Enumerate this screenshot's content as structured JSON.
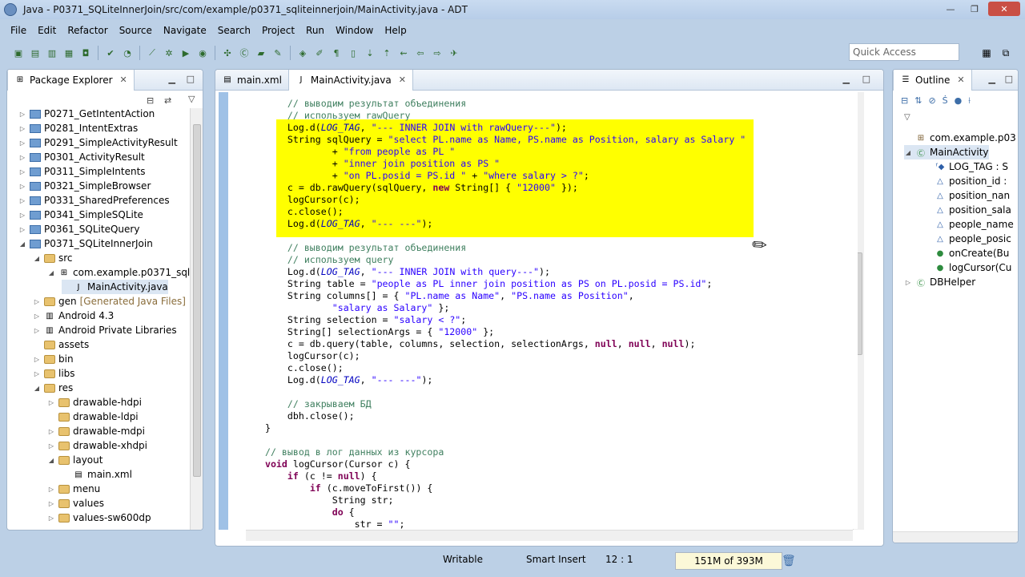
{
  "window": {
    "title": "Java - P0371_SQLiteInnerJoin/src/com/example/p0371_sqliteinnerjoin/MainActivity.java - ADT",
    "controls": [
      "—",
      "❐",
      "✕"
    ]
  },
  "menu": [
    "File",
    "Edit",
    "Refactor",
    "Source",
    "Navigate",
    "Search",
    "Project",
    "Run",
    "Window",
    "Help"
  ],
  "quick_access": {
    "placeholder": "Quick Access"
  },
  "package_explorer": {
    "tab_label": "Package Explorer",
    "items": [
      {
        "label": "P0271_GetIntentAction",
        "indent": 0,
        "expanded": false,
        "icon": "project-icon"
      },
      {
        "label": "P0281_IntentExtras",
        "indent": 0,
        "expanded": false,
        "icon": "project-icon"
      },
      {
        "label": "P0291_SimpleActivityResult",
        "indent": 0,
        "expanded": false,
        "icon": "project-icon"
      },
      {
        "label": "P0301_ActivityResult",
        "indent": 0,
        "expanded": false,
        "icon": "project-icon"
      },
      {
        "label": "P0311_SimpleIntents",
        "indent": 0,
        "expanded": false,
        "icon": "project-icon"
      },
      {
        "label": "P0321_SimpleBrowser",
        "indent": 0,
        "expanded": false,
        "icon": "project-icon"
      },
      {
        "label": "P0331_SharedPreferences",
        "indent": 0,
        "expanded": false,
        "icon": "project-icon"
      },
      {
        "label": "P0341_SimpleSQLite",
        "indent": 0,
        "expanded": false,
        "icon": "project-icon"
      },
      {
        "label": "P0361_SQLiteQuery",
        "indent": 0,
        "expanded": false,
        "icon": "project-icon"
      },
      {
        "label": "P0371_SQLiteInnerJoin",
        "indent": 0,
        "expanded": true,
        "icon": "project-icon"
      },
      {
        "label": "src",
        "indent": 1,
        "expanded": true,
        "icon": "folder-icon"
      },
      {
        "label": "com.example.p0371_sqlit",
        "indent": 2,
        "expanded": true,
        "icon": "package-icon"
      },
      {
        "label": "MainActivity.java",
        "indent": 3,
        "expanded": null,
        "icon": "java-file-icon",
        "selected": true
      },
      {
        "label": "gen",
        "suffix": "[Generated Java Files]",
        "indent": 1,
        "expanded": false,
        "icon": "folder-icon"
      },
      {
        "label": "Android 4.3",
        "indent": 1,
        "expanded": false,
        "icon": "library-icon"
      },
      {
        "label": "Android Private Libraries",
        "indent": 1,
        "expanded": false,
        "icon": "library-icon"
      },
      {
        "label": "assets",
        "indent": 1,
        "expanded": null,
        "icon": "folder-icon"
      },
      {
        "label": "bin",
        "indent": 1,
        "expanded": false,
        "icon": "folder-icon"
      },
      {
        "label": "libs",
        "indent": 1,
        "expanded": false,
        "icon": "folder-icon"
      },
      {
        "label": "res",
        "indent": 1,
        "expanded": true,
        "icon": "folder-icon"
      },
      {
        "label": "drawable-hdpi",
        "indent": 2,
        "expanded": false,
        "icon": "folder-icon"
      },
      {
        "label": "drawable-ldpi",
        "indent": 2,
        "expanded": null,
        "icon": "folder-icon"
      },
      {
        "label": "drawable-mdpi",
        "indent": 2,
        "expanded": false,
        "icon": "folder-icon"
      },
      {
        "label": "drawable-xhdpi",
        "indent": 2,
        "expanded": false,
        "icon": "folder-icon"
      },
      {
        "label": "layout",
        "indent": 2,
        "expanded": true,
        "icon": "folder-icon"
      },
      {
        "label": "main.xml",
        "indent": 3,
        "expanded": null,
        "icon": "xml-file-icon"
      },
      {
        "label": "menu",
        "indent": 2,
        "expanded": false,
        "icon": "folder-icon"
      },
      {
        "label": "values",
        "indent": 2,
        "expanded": false,
        "icon": "folder-icon"
      },
      {
        "label": "values-sw600dp",
        "indent": 2,
        "expanded": false,
        "icon": "folder-icon"
      }
    ]
  },
  "editor": {
    "tabs": [
      {
        "label": "main.xml",
        "active": false
      },
      {
        "label": "MainActivity.java",
        "active": true
      }
    ],
    "lines": [
      [
        {
          "t": "      ",
          "c": ""
        },
        {
          "t": "// выводим результат объединения",
          "c": "cm"
        }
      ],
      [
        {
          "t": "      ",
          "c": ""
        },
        {
          "t": "// используем rawQuery",
          "c": "cm"
        }
      ],
      [
        {
          "t": "      Log.d(",
          "c": ""
        },
        {
          "t": "LOG_TAG",
          "c": "fld"
        },
        {
          "t": ", ",
          "c": ""
        },
        {
          "t": "\"--- INNER JOIN with rawQuery---\"",
          "c": "str"
        },
        {
          "t": ");",
          "c": ""
        }
      ],
      [
        {
          "t": "      String sqlQuery = ",
          "c": ""
        },
        {
          "t": "\"select PL.name as Name, PS.name as Position, salary as Salary \"",
          "c": "str"
        }
      ],
      [
        {
          "t": "              + ",
          "c": ""
        },
        {
          "t": "\"from people as PL \"",
          "c": "str"
        }
      ],
      [
        {
          "t": "              + ",
          "c": ""
        },
        {
          "t": "\"inner join position as PS \"",
          "c": "str"
        }
      ],
      [
        {
          "t": "              + ",
          "c": ""
        },
        {
          "t": "\"on PL.posid = PS.id \"",
          "c": "str"
        },
        {
          "t": " + ",
          "c": ""
        },
        {
          "t": "\"where salary > ?\"",
          "c": "str"
        },
        {
          "t": ";",
          "c": ""
        }
      ],
      [
        {
          "t": "      c = db.rawQuery(sqlQuery, ",
          "c": ""
        },
        {
          "t": "new",
          "c": "kw"
        },
        {
          "t": " String[] { ",
          "c": ""
        },
        {
          "t": "\"12000\"",
          "c": "str"
        },
        {
          "t": " });",
          "c": ""
        }
      ],
      [
        {
          "t": "      logCursor(c);",
          "c": ""
        }
      ],
      [
        {
          "t": "      c.close();",
          "c": ""
        }
      ],
      [
        {
          "t": "      Log.d(",
          "c": ""
        },
        {
          "t": "LOG_TAG",
          "c": "fld"
        },
        {
          "t": ", ",
          "c": ""
        },
        {
          "t": "\"--- ---\"",
          "c": "str"
        },
        {
          "t": ");",
          "c": ""
        }
      ],
      [
        {
          "t": "",
          "c": ""
        }
      ],
      [
        {
          "t": "      ",
          "c": ""
        },
        {
          "t": "// выводим результат объединения",
          "c": "cm"
        }
      ],
      [
        {
          "t": "      ",
          "c": ""
        },
        {
          "t": "// используем query",
          "c": "cm"
        }
      ],
      [
        {
          "t": "      Log.d(",
          "c": ""
        },
        {
          "t": "LOG_TAG",
          "c": "fld"
        },
        {
          "t": ", ",
          "c": ""
        },
        {
          "t": "\"--- INNER JOIN with query---\"",
          "c": "str"
        },
        {
          "t": ");",
          "c": ""
        }
      ],
      [
        {
          "t": "      String table = ",
          "c": ""
        },
        {
          "t": "\"people as PL inner join position as PS on PL.posid = PS.id\"",
          "c": "str"
        },
        {
          "t": ";",
          "c": ""
        }
      ],
      [
        {
          "t": "      String columns[] = { ",
          "c": ""
        },
        {
          "t": "\"PL.name as Name\"",
          "c": "str"
        },
        {
          "t": ", ",
          "c": ""
        },
        {
          "t": "\"PS.name as Position\"",
          "c": "str"
        },
        {
          "t": ",",
          "c": ""
        }
      ],
      [
        {
          "t": "              ",
          "c": ""
        },
        {
          "t": "\"salary as Salary\"",
          "c": "str"
        },
        {
          "t": " };",
          "c": ""
        }
      ],
      [
        {
          "t": "      String selection = ",
          "c": ""
        },
        {
          "t": "\"salary < ?\"",
          "c": "str"
        },
        {
          "t": ";",
          "c": ""
        }
      ],
      [
        {
          "t": "      String[] selectionArgs = { ",
          "c": ""
        },
        {
          "t": "\"12000\"",
          "c": "str"
        },
        {
          "t": " };",
          "c": ""
        }
      ],
      [
        {
          "t": "      c = db.query(table, columns, selection, selectionArgs, ",
          "c": ""
        },
        {
          "t": "null",
          "c": "kw"
        },
        {
          "t": ", ",
          "c": ""
        },
        {
          "t": "null",
          "c": "kw"
        },
        {
          "t": ", ",
          "c": ""
        },
        {
          "t": "null",
          "c": "kw"
        },
        {
          "t": ");",
          "c": ""
        }
      ],
      [
        {
          "t": "      logCursor(c);",
          "c": ""
        }
      ],
      [
        {
          "t": "      c.close();",
          "c": ""
        }
      ],
      [
        {
          "t": "      Log.d(",
          "c": ""
        },
        {
          "t": "LOG_TAG",
          "c": "fld"
        },
        {
          "t": ", ",
          "c": ""
        },
        {
          "t": "\"--- ---\"",
          "c": "str"
        },
        {
          "t": ");",
          "c": ""
        }
      ],
      [
        {
          "t": "",
          "c": ""
        }
      ],
      [
        {
          "t": "      ",
          "c": ""
        },
        {
          "t": "// закрываем БД",
          "c": "cm"
        }
      ],
      [
        {
          "t": "      dbh.close();",
          "c": ""
        }
      ],
      [
        {
          "t": "  }",
          "c": ""
        }
      ],
      [
        {
          "t": "",
          "c": ""
        }
      ],
      [
        {
          "t": "  ",
          "c": ""
        },
        {
          "t": "// вывод в лог данных из курсора",
          "c": "cm"
        }
      ],
      [
        {
          "t": "  ",
          "c": ""
        },
        {
          "t": "void",
          "c": "kw"
        },
        {
          "t": " logCursor(Cursor c) {",
          "c": ""
        }
      ],
      [
        {
          "t": "      ",
          "c": ""
        },
        {
          "t": "if",
          "c": "kw"
        },
        {
          "t": " (c != ",
          "c": ""
        },
        {
          "t": "null",
          "c": "kw"
        },
        {
          "t": ") {",
          "c": ""
        }
      ],
      [
        {
          "t": "          ",
          "c": ""
        },
        {
          "t": "if",
          "c": "kw"
        },
        {
          "t": " (c.moveToFirst()) {",
          "c": ""
        }
      ],
      [
        {
          "t": "              String str;",
          "c": ""
        }
      ],
      [
        {
          "t": "              ",
          "c": ""
        },
        {
          "t": "do",
          "c": "kw"
        },
        {
          "t": " {",
          "c": ""
        }
      ],
      [
        {
          "t": "                  str = ",
          "c": ""
        },
        {
          "t": "\"\"",
          "c": "str"
        },
        {
          "t": ";",
          "c": ""
        }
      ]
    ]
  },
  "outline": {
    "tab_label": "Outline",
    "items": [
      {
        "label": "com.example.p03",
        "indent": 0,
        "icon": "import-icon",
        "twisty": ""
      },
      {
        "label": "MainActivity",
        "indent": 0,
        "icon": "class-icon",
        "twisty": "◢",
        "selected": true
      },
      {
        "label": "LOG_TAG : S",
        "indent": 1,
        "icon": "final-field-icon",
        "twisty": ""
      },
      {
        "label": "position_id :",
        "indent": 1,
        "icon": "field-icon",
        "twisty": ""
      },
      {
        "label": "position_nan",
        "indent": 1,
        "icon": "field-icon",
        "twisty": ""
      },
      {
        "label": "position_sala",
        "indent": 1,
        "icon": "field-icon",
        "twisty": ""
      },
      {
        "label": "people_name",
        "indent": 1,
        "icon": "field-icon",
        "twisty": ""
      },
      {
        "label": "people_posic",
        "indent": 1,
        "icon": "field-icon",
        "twisty": ""
      },
      {
        "label": "onCreate(Bu",
        "indent": 1,
        "icon": "method-icon",
        "twisty": ""
      },
      {
        "label": "logCursor(Cu",
        "indent": 1,
        "icon": "method-icon",
        "twisty": ""
      },
      {
        "label": "DBHelper",
        "indent": 0,
        "icon": "class-icon",
        "twisty": "▷"
      }
    ]
  },
  "status": {
    "mode": "Writable",
    "insert": "Smart Insert",
    "position": "12 : 1",
    "memory": "151M of 393M"
  }
}
